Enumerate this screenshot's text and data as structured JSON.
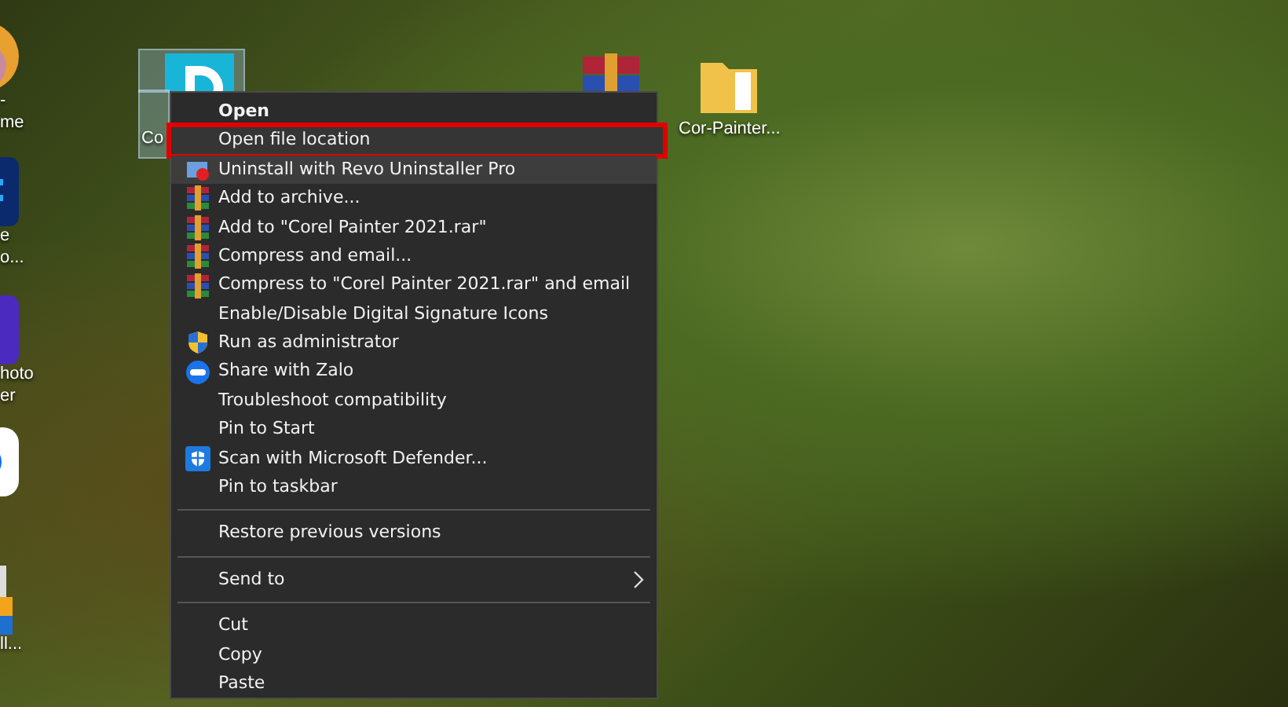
{
  "desktop": {
    "left_icons": [
      {
        "kind": "photo",
        "lines": [
          "-",
          "me"
        ]
      },
      {
        "kind": "app-blue",
        "lines": [
          "e",
          "o..."
        ]
      },
      {
        "kind": "app-purple",
        "lines": [
          "hoto",
          "er"
        ]
      },
      {
        "kind": "zalo"
      },
      {
        "kind": "installer",
        "lines": [
          "ll..."
        ]
      }
    ],
    "icons": [
      {
        "kind": "painter",
        "label": "Co",
        "selected": true
      },
      {
        "kind": "winrar",
        "selected": false
      },
      {
        "kind": "folder",
        "label": "Cor-Painter...",
        "selected": false
      }
    ]
  },
  "context_menu": {
    "items": [
      {
        "kind": "default",
        "label": "Open",
        "selected": false,
        "hovered": false
      },
      {
        "kind": "plain",
        "label": "Open file location",
        "selected": true,
        "hovered": false
      },
      {
        "kind": "uninstall",
        "label": "Uninstall with Revo Uninstaller Pro",
        "selected": false,
        "hovered": true
      },
      {
        "kind": "archive",
        "label": "Add to archive...",
        "selected": false,
        "hovered": false
      },
      {
        "kind": "archive",
        "label": "Add to \"Corel Painter 2021.rar\"",
        "selected": false,
        "hovered": false
      },
      {
        "kind": "archive",
        "label": "Compress and email...",
        "selected": false,
        "hovered": false
      },
      {
        "kind": "archive",
        "label": "Compress to \"Corel Painter 2021.rar\" and email",
        "selected": false,
        "hovered": false
      },
      {
        "kind": "plain",
        "label": "Enable/Disable Digital Signature Icons",
        "selected": false,
        "hovered": false
      },
      {
        "kind": "admin",
        "label": "Run as administrator",
        "selected": false,
        "hovered": false
      },
      {
        "kind": "chat",
        "label": "Share with Zalo",
        "selected": false,
        "hovered": false
      },
      {
        "kind": "plain",
        "label": "Troubleshoot compatibility",
        "selected": false,
        "hovered": false
      },
      {
        "kind": "plain",
        "label": "Pin to Start",
        "selected": false,
        "hovered": false
      },
      {
        "kind": "defender",
        "label": "Scan with Microsoft Defender...",
        "selected": false,
        "hovered": false
      },
      {
        "kind": "plain",
        "label": "Pin to taskbar",
        "selected": false,
        "hovered": false
      },
      {
        "kind": "separator"
      },
      {
        "kind": "plain",
        "label": "Restore previous versions",
        "selected": false,
        "hovered": false
      },
      {
        "kind": "separator"
      },
      {
        "kind": "submenu",
        "label": "Send to",
        "selected": false,
        "hovered": false
      },
      {
        "kind": "separator"
      },
      {
        "kind": "plain",
        "label": "Cut",
        "selected": false,
        "hovered": false
      },
      {
        "kind": "plain",
        "label": "Copy",
        "selected": false,
        "hovered": false
      },
      {
        "kind": "plain",
        "label": "Paste",
        "selected": false,
        "hovered": false
      }
    ]
  }
}
